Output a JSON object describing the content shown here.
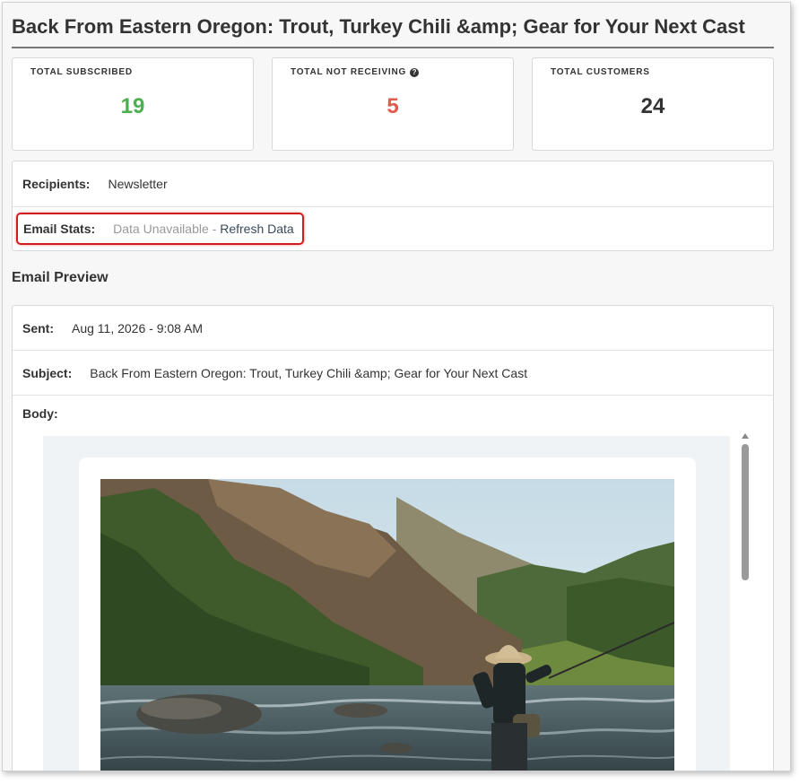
{
  "page": {
    "title": "Back From Eastern Oregon: Trout, Turkey Chili &amp; Gear for Your Next Cast"
  },
  "stats": [
    {
      "label": "TOTAL SUBSCRIBED",
      "value": "19",
      "color": "#4caf50"
    },
    {
      "label": "TOTAL NOT RECEIVING",
      "value": "5",
      "color": "#e05a4f",
      "help_icon": "question-circle-icon"
    },
    {
      "label": "TOTAL CUSTOMERS",
      "value": "24",
      "color": "#333333"
    }
  ],
  "info": {
    "recipients_label": "Recipients:",
    "recipients_value": "Newsletter",
    "email_stats_label": "Email Stats:",
    "email_stats_status": "Data Unavailable",
    "email_stats_separator": " - ",
    "refresh_link": "Refresh Data"
  },
  "preview": {
    "heading": "Email Preview",
    "sent_label": "Sent:",
    "sent_value": "Aug 11, 2026 - 9:08 AM",
    "subject_label": "Subject:",
    "subject_value": "Back From Eastern Oregon: Trout, Turkey Chili &amp; Gear for Your Next Cast",
    "body_label": "Body:",
    "hero_image": "fly-fisherman-river-canyon-photo"
  },
  "colors": {
    "highlight": "#d01c1c",
    "subscribed": "#4caf50",
    "not_receiving": "#e05a4f"
  }
}
